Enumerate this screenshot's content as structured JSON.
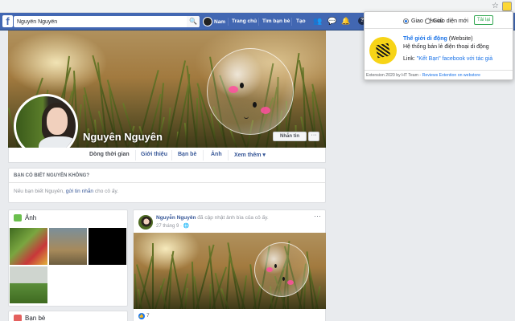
{
  "search": {
    "value": "Nguyên Nguyên"
  },
  "nav": {
    "user": "Nam",
    "home": "Trang chủ",
    "find_friends": "Tìm bạn bè",
    "create": "Tạo",
    "help": "?"
  },
  "profile": {
    "name": "Nguyên Nguyên",
    "message_button": "Nhắn tin",
    "more_button": "···"
  },
  "tabs": [
    "Dòng thời gian",
    "Giới thiệu",
    "Bạn bè",
    "Ảnh",
    "Xem thêm ▾"
  ],
  "know": {
    "heading": "BẠN CÓ BIẾT NGUYÊN KHÔNG?",
    "prefix": "Nếu bạn biết Nguyên,",
    "link": "gửi tin nhắn",
    "suffix": "cho cô ấy."
  },
  "photos": {
    "title": "Ảnh"
  },
  "friends": {
    "title": "Bạn bè"
  },
  "post": {
    "author": "Nguyễn Nguyên",
    "action": "đã cập nhật ảnh bìa của cô ấy.",
    "date": "27 tháng 9 · 🌐",
    "more": "···",
    "like_icon": "👍",
    "like_count": "7"
  },
  "popup": {
    "option_old": "Giao diện cũ",
    "option_new": "Giao diện mới",
    "selected": "old",
    "reload": "Tải lại",
    "store_name": "Thế giới di động",
    "store_type": "(Website)",
    "store_desc": "Hệ thống bán lẻ điện thoại di động",
    "link_label": "Link:",
    "link_text": "\"Kết Bạn\" facebook với tác giả",
    "footer_text": "Extension 2020 by HT Team -",
    "footer_link": "Reviews Extention on webstore"
  },
  "colors": {
    "fb_blue": "#4267b2",
    "link_blue": "#385898",
    "popup_link": "#1a73e8",
    "reload_green": "#34a853",
    "logo_yellow": "#f7d417"
  },
  "icons": {
    "star": "☆",
    "search": "🔍",
    "friends": "👥",
    "messenger": "💬",
    "notifications": "🔔"
  }
}
